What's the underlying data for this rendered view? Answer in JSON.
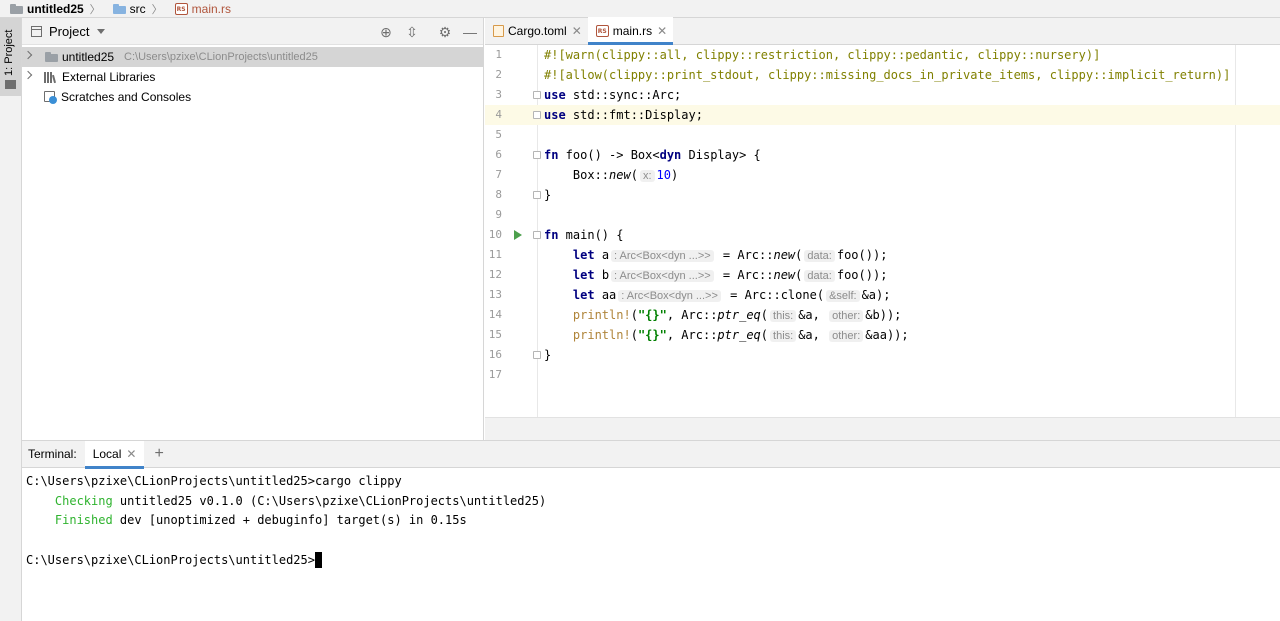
{
  "breadcrumb": {
    "project": "untitled25",
    "folder": "src",
    "file": "main.rs"
  },
  "toolstrip": {
    "project_tab": "1: Project"
  },
  "project_panel": {
    "title": "Project",
    "tree": [
      {
        "label": "untitled25",
        "path": "C:\\Users\\pzixe\\CLionProjects\\untitled25"
      },
      {
        "label": "External Libraries"
      },
      {
        "label": "Scratches and Consoles"
      }
    ]
  },
  "editor": {
    "tabs": [
      {
        "label": "Cargo.toml"
      },
      {
        "label": "main.rs"
      }
    ],
    "line_numbers": [
      "1",
      "2",
      "3",
      "4",
      "5",
      "6",
      "7",
      "8",
      "9",
      "10",
      "11",
      "12",
      "13",
      "14",
      "15",
      "16",
      "17"
    ],
    "code": {
      "l1": "#![warn(clippy::all, clippy::restriction, clippy::pedantic, clippy::nursery)]",
      "l2": "#![allow(clippy::print_stdout, clippy::missing_docs_in_private_items, clippy::implicit_return)]",
      "use": "use",
      "l3_rest": " std::sync::Arc;",
      "l4_rest": " std::fmt::Display;",
      "fn": "fn",
      "l6_rest": " foo() -> Box<",
      "dyn": "dyn",
      "l6_end": " Display> {",
      "l7_pre": "    Box::",
      "new": "new",
      "l7_open": "(",
      "hint_x": "x:",
      "l7_num": "10",
      "l7_close": ")",
      "brace_close": "}",
      "l10_rest": " main() {",
      "indent": "    ",
      "let": "let",
      "var_a": " a",
      "var_b": " b",
      "var_aa": " aa",
      "type_hint": ": Arc<Box<dyn ...>>",
      "eq_arc": " = Arc::",
      "hint_data": "data:",
      "foo_call": "foo());",
      "clone": "clone(",
      "hint_self": "&self:",
      "l13_arg": "&a);",
      "println": "println!",
      "open_paren": "(",
      "fmt_str": "\"{}\"",
      "comma_arc": ", Arc::",
      "ptr_eq": "ptr_eq",
      "hint_this": "this:",
      "amp_a": "&a,",
      "hint_other": "other:",
      "l14_end": "&b));",
      "l15_end": "&aa));"
    }
  },
  "terminal": {
    "label": "Terminal:",
    "tab": "Local",
    "lines": {
      "cmd": "C:\\Users\\pzixe\\CLionProjects\\untitled25>cargo clippy",
      "checking": "Checking",
      "checking_rest": " untitled25 v0.1.0 (C:\\Users\\pzixe\\CLionProjects\\untitled25)",
      "finished": "Finished",
      "finished_rest": " dev [unoptimized + debuginfo] target(s) in 0.15s",
      "prompt": "C:\\Users\\pzixe\\CLionProjects\\untitled25>"
    }
  },
  "colors": {
    "accent": "#4083c9",
    "keyword": "#000080",
    "attribute": "#808000",
    "terminal_green": "#2fb32f",
    "current_line": "#fdfae6"
  }
}
